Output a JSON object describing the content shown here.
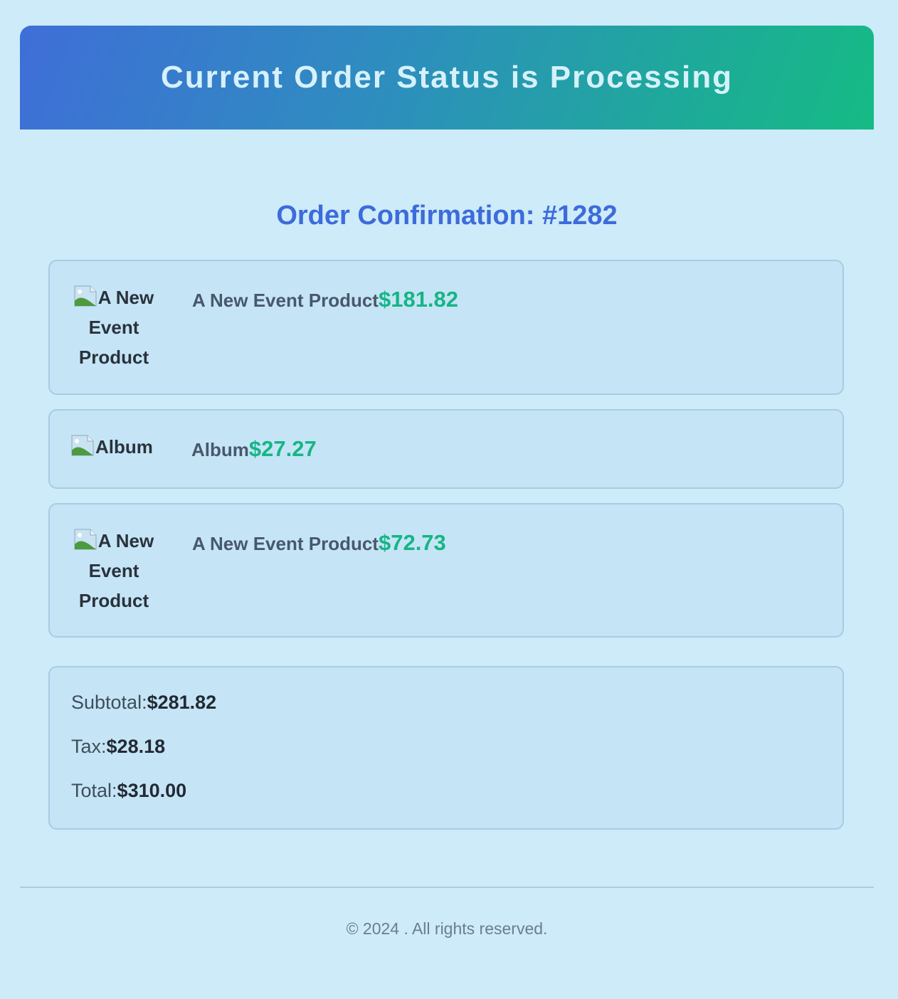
{
  "header": {
    "title": "Current Order Status is Processing"
  },
  "order": {
    "confirmation_title": "Order Confirmation: #1282"
  },
  "items": [
    {
      "image_alt": "A New Event Product",
      "name": "A New Event Product",
      "price": "$181.82"
    },
    {
      "image_alt": "Album",
      "name": "Album",
      "price": "$27.27"
    },
    {
      "image_alt": "A New Event Product",
      "name": "A New Event Product",
      "price": "$72.73"
    }
  ],
  "summary": {
    "subtotal_label": "Subtotal:",
    "subtotal_value": "$281.82",
    "tax_label": "Tax:",
    "tax_value": "$28.18",
    "total_label": "Total:",
    "total_value": "$310.00"
  },
  "footer": {
    "copyright": "© 2024 . All rights reserved."
  },
  "colors": {
    "background": "#cdebf8",
    "accent_blue": "#3d6bdc",
    "price_green": "#16b585",
    "header_gradient_start": "#3f6ed8",
    "header_gradient_end": "#15bb84"
  },
  "icons": {
    "item_image": "broken-image-icon"
  }
}
